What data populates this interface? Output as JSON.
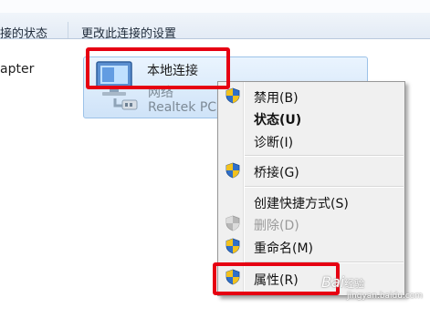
{
  "toolbar": {
    "item1": "接的状态",
    "item2": "更改此连接的设置"
  },
  "left_label": "apter",
  "adapter": {
    "name": "本地连接",
    "network": "网络",
    "device": "Realtek PC"
  },
  "menu": {
    "items": [
      {
        "label": "禁用(B)",
        "icon": "shield-icon",
        "state": "normal"
      },
      {
        "label": "状态(U)",
        "icon": "",
        "state": "default-bold"
      },
      {
        "label": "诊断(I)",
        "icon": "",
        "state": "normal"
      },
      {
        "label": "桥接(G)",
        "icon": "shield-icon",
        "state": "normal"
      },
      {
        "label": "创建快捷方式(S)",
        "icon": "",
        "state": "normal"
      },
      {
        "label": "删除(D)",
        "icon": "shield-icon",
        "state": "disabled"
      },
      {
        "label": "重命名(M)",
        "icon": "shield-icon",
        "state": "normal"
      },
      {
        "label": "属性(R)",
        "icon": "shield-icon",
        "state": "normal"
      }
    ]
  },
  "watermark": {
    "text": "Bai",
    "sub": "经验",
    "url": "jingyan.baidu.com"
  },
  "colors": {
    "highlight_box": "#e60012",
    "shield_blue": "#2f6fc9",
    "shield_yellow": "#f2c11d",
    "selection": "#cfe3f8"
  }
}
